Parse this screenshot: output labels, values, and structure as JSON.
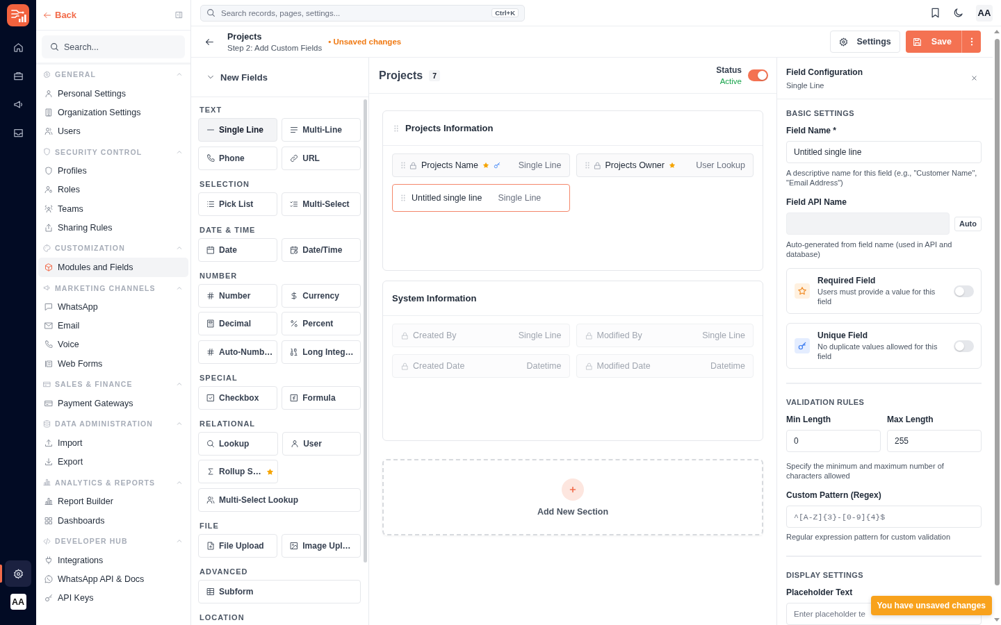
{
  "rail": {
    "items": [
      {
        "selected": false
      },
      {
        "selected": false
      },
      {
        "selected": false
      },
      {
        "selected": false
      }
    ],
    "footer_items": [
      {
        "selected": true
      }
    ],
    "avatar": "AA"
  },
  "sidebar": {
    "back": "Back",
    "search": {
      "placeholder": "Search..."
    },
    "groups": [
      {
        "title": "GENERAL",
        "expanded": true,
        "items": [
          {
            "label": "Personal Settings",
            "selected": false
          },
          {
            "label": "Organization Settings",
            "selected": false
          },
          {
            "label": "Users",
            "selected": false
          }
        ]
      },
      {
        "title": "SECURITY CONTROL",
        "expanded": true,
        "items": [
          {
            "label": "Profiles",
            "selected": false
          },
          {
            "label": "Roles",
            "selected": false
          },
          {
            "label": "Teams",
            "selected": false
          },
          {
            "label": "Sharing Rules",
            "selected": false
          }
        ]
      },
      {
        "title": "CUSTOMIZATION",
        "expanded": true,
        "items": [
          {
            "label": "Modules and Fields",
            "selected": true
          }
        ]
      },
      {
        "title": "MARKETING CHANNELS",
        "expanded": true,
        "items": [
          {
            "label": "WhatsApp",
            "selected": false
          },
          {
            "label": "Email",
            "selected": false
          },
          {
            "label": "Voice",
            "selected": false
          },
          {
            "label": "Web Forms",
            "selected": false
          }
        ]
      },
      {
        "title": "SALES & FINANCE",
        "expanded": true,
        "items": [
          {
            "label": "Payment Gateways",
            "selected": false
          }
        ]
      },
      {
        "title": "DATA ADMINISTRATION",
        "expanded": true,
        "items": [
          {
            "label": "Import",
            "selected": false
          },
          {
            "label": "Export",
            "selected": false
          }
        ]
      },
      {
        "title": "ANALYTICS & REPORTS",
        "expanded": true,
        "items": [
          {
            "label": "Report Builder",
            "selected": false
          },
          {
            "label": "Dashboards",
            "selected": false
          }
        ]
      },
      {
        "title": "DEVELOPER HUB",
        "expanded": true,
        "items": [
          {
            "label": "Integrations",
            "selected": false
          },
          {
            "label": "WhatsApp API & Docs",
            "selected": false
          },
          {
            "label": "API Keys",
            "selected": false
          }
        ]
      }
    ]
  },
  "top_bar": {
    "search": {
      "placeholder": "Search records, pages, settings...",
      "shortcut": "Ctrl+K"
    },
    "avatar": "AA"
  },
  "page_header": {
    "title": "Projects",
    "subtitle": "Step 2: Add Custom Fields",
    "status": "• Unsaved changes",
    "settings_button": "Settings",
    "save_button": "Save"
  },
  "palette": {
    "title": "New Fields",
    "expanded": true,
    "groups": [
      {
        "title": "TEXT",
        "items": [
          {
            "label": "Single Line",
            "selected": true,
            "wide": false,
            "starred": false
          },
          {
            "label": "Multi-Line",
            "selected": false,
            "wide": false,
            "starred": false
          },
          {
            "label": "Phone",
            "selected": false,
            "wide": false,
            "starred": false
          },
          {
            "label": "URL",
            "selected": false,
            "wide": false,
            "starred": false
          }
        ]
      },
      {
        "title": "SELECTION",
        "items": [
          {
            "label": "Pick List",
            "selected": false,
            "wide": false,
            "starred": false
          },
          {
            "label": "Multi-Select",
            "selected": false,
            "wide": false,
            "starred": false
          }
        ]
      },
      {
        "title": "DATE & TIME",
        "items": [
          {
            "label": "Date",
            "selected": false,
            "wide": false,
            "starred": false
          },
          {
            "label": "Date/Time",
            "selected": false,
            "wide": false,
            "starred": false
          }
        ]
      },
      {
        "title": "NUMBER",
        "items": [
          {
            "label": "Number",
            "selected": false,
            "wide": false,
            "starred": false
          },
          {
            "label": "Currency",
            "selected": false,
            "wide": false,
            "starred": false
          },
          {
            "label": "Decimal",
            "selected": false,
            "wide": false,
            "starred": false
          },
          {
            "label": "Percent",
            "selected": false,
            "wide": false,
            "starred": false
          },
          {
            "label": "Auto-Numb…",
            "selected": false,
            "wide": false,
            "starred": false
          },
          {
            "label": "Long Integ…",
            "selected": false,
            "wide": false,
            "starred": false
          }
        ]
      },
      {
        "title": "SPECIAL",
        "items": [
          {
            "label": "Checkbox",
            "selected": false,
            "wide": false,
            "starred": false
          },
          {
            "label": "Formula",
            "selected": false,
            "wide": false,
            "starred": false
          }
        ]
      },
      {
        "title": "RELATIONAL",
        "items": [
          {
            "label": "Lookup",
            "selected": false,
            "wide": false,
            "starred": false
          },
          {
            "label": "User",
            "selected": false,
            "wide": false,
            "starred": false
          },
          {
            "label": "Rollup S…",
            "selected": false,
            "wide": false,
            "starred": true
          },
          {
            "label": "Multi-Select Lookup",
            "selected": false,
            "wide": true,
            "starred": false
          }
        ]
      },
      {
        "title": "FILE",
        "items": [
          {
            "label": "File Upload",
            "selected": false,
            "wide": false,
            "starred": false
          },
          {
            "label": "Image Upl…",
            "selected": false,
            "wide": false,
            "starred": false
          }
        ]
      },
      {
        "title": "ADVANCED",
        "items": [
          {
            "label": "Subform",
            "selected": false,
            "wide": true,
            "starred": false
          }
        ]
      },
      {
        "title": "LOCATION"
      }
    ]
  },
  "canvas": {
    "title": "Projects",
    "count": "7",
    "status_label": "Status",
    "status": "Active",
    "active": true,
    "sections": [
      {
        "title": "Projects Information",
        "kind": "custom",
        "fields": [
          {
            "name": "Projects Name",
            "type": "Single Line",
            "locked": true,
            "required": true,
            "unique": true,
            "selected": false
          },
          {
            "name": "Projects Owner",
            "type": "User Lookup",
            "locked": true,
            "required": true,
            "unique": false,
            "selected": false
          },
          {
            "name": "Untitled single line",
            "type": "Single Line",
            "locked": false,
            "required": false,
            "unique": false,
            "selected": true
          }
        ]
      },
      {
        "title": "System Information",
        "kind": "system",
        "fields": [
          {
            "name": "Created By",
            "type": "Single Line",
            "locked": true,
            "required": false,
            "unique": false,
            "selected": false
          },
          {
            "name": "Modified By",
            "type": "Single Line",
            "locked": true,
            "required": false,
            "unique": false,
            "selected": false
          },
          {
            "name": "Created Date",
            "type": "Datetime",
            "locked": true,
            "required": false,
            "unique": false,
            "selected": false
          },
          {
            "name": "Modified Date",
            "type": "Datetime",
            "locked": true,
            "required": false,
            "unique": false,
            "selected": false
          }
        ]
      }
    ],
    "add_section": "Add New Section"
  },
  "config": {
    "title": "Field Configuration",
    "subtitle": "Single Line",
    "basic": {
      "heading": "BASIC SETTINGS",
      "field_name": {
        "label": "Field Name *",
        "value": "Untitled single line",
        "help": "A descriptive name for this field (e.g., \"Customer Name\", \"Email Address\")"
      },
      "api_name": {
        "label": "Field API Name",
        "disabled": true,
        "button": "Auto",
        "help": "Auto-generated from field name (used in API and database)"
      },
      "toggles": [
        {
          "title": "Required Field",
          "description": "Users must provide a value for this field",
          "on": false
        },
        {
          "title": "Unique Field",
          "description": "No duplicate values allowed for this field",
          "on": false
        }
      ]
    },
    "validation": {
      "heading": "VALIDATION RULES",
      "min": {
        "label": "Min Length",
        "value": "0"
      },
      "max": {
        "label": "Max Length",
        "value": "255"
      },
      "help": "Specify the minimum and maximum number of characters allowed",
      "pattern": {
        "label": "Custom Pattern (Regex)",
        "placeholder": "^[A-Z]{3}-[0-9]{4}$",
        "help": "Regular expression pattern for custom validation"
      }
    },
    "display": {
      "heading": "DISPLAY SETTINGS",
      "placeholder_text": {
        "label": "Placeholder Text",
        "placeholder": "Enter placeholder te"
      }
    }
  },
  "toast": "You have unsaved changes"
}
